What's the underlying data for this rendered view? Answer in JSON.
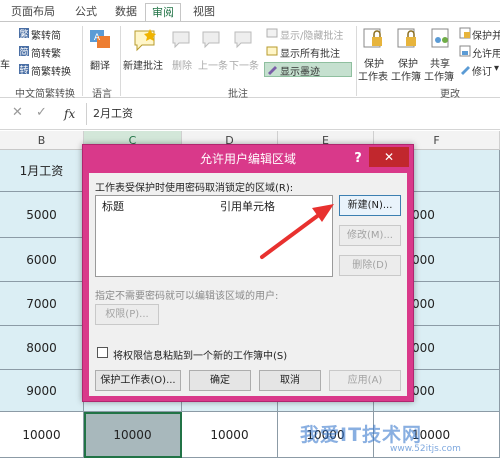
{
  "ribbon": {
    "tabs": [
      {
        "label": "页面布局",
        "active": false
      },
      {
        "label": "公式",
        "active": false
      },
      {
        "label": "数据",
        "active": false
      },
      {
        "label": "审阅",
        "active": true
      },
      {
        "label": "视图",
        "active": false
      }
    ],
    "chinese_conv": {
      "to_simplified": "繁转简",
      "to_traditional": "简转繁",
      "convert": "简繁转换",
      "group_label": "中文简繁转换"
    },
    "left_partial": "车",
    "language": {
      "translate": "翻译",
      "group_label": "语言"
    },
    "comments": {
      "new": "新建批注",
      "delete": "删除",
      "prev": "上一条",
      "next": "下一条",
      "show_hide": "显示/隐藏批注",
      "show_all": "显示所有批注",
      "show_ink": "显示墨迹",
      "group_label": "批注"
    },
    "changes": {
      "protect_sheet": [
        "保护",
        "工作表"
      ],
      "protect_workbook": [
        "保护",
        "工作簿"
      ],
      "share_workbook": [
        "共享",
        "工作簿"
      ],
      "protect_share": "保护并",
      "allow_edit": "允许用",
      "track": "修订",
      "group_label": "更改"
    }
  },
  "formula_bar": {
    "value": "2月工资",
    "fx": "fx"
  },
  "grid": {
    "columns": [
      "B",
      "C",
      "D",
      "E",
      "F"
    ],
    "selected_column": "C",
    "rows": [
      [
        "1月工资",
        "2月工资",
        "",
        "",
        ""
      ],
      [
        "5000",
        "",
        "",
        "",
        "000"
      ],
      [
        "6000",
        "",
        "",
        "",
        "000"
      ],
      [
        "7000",
        "",
        "",
        "",
        "000"
      ],
      [
        "8000",
        "",
        "",
        "",
        "000"
      ],
      [
        "9000",
        "",
        "",
        "",
        "000"
      ],
      [
        "10000",
        "10000",
        "10000",
        "10000",
        "10000"
      ]
    ]
  },
  "dialog": {
    "title": "允许用户编辑区域",
    "help": "?",
    "close": "✕",
    "unlocked_label": "工作表受保护时使用密码取消锁定的区域(R):",
    "list_headers": {
      "title": "标题",
      "ref": "引用单元格"
    },
    "buttons": {
      "new": "新建(N)...",
      "modify": "修改(M)...",
      "delete": "删除(D)",
      "permissions": "权限(P)...",
      "protect_sheet": "保护工作表(O)...",
      "ok": "确定",
      "cancel": "取消",
      "apply": "应用(A)"
    },
    "no_password_label": "指定不需要密码就可以编辑该区域的用户:",
    "paste_checkbox": "将权限信息粘贴到一个新的工作簿中(S)"
  },
  "watermark": {
    "main": "我爱IT技术网",
    "sub": "www.52itjs.com"
  },
  "colors": {
    "dialog_border": "#d9398a",
    "close_button": "#c1272d",
    "excel_green": "#217346",
    "cell_blue": "#dbeef4",
    "arrow": "#e8312f"
  }
}
